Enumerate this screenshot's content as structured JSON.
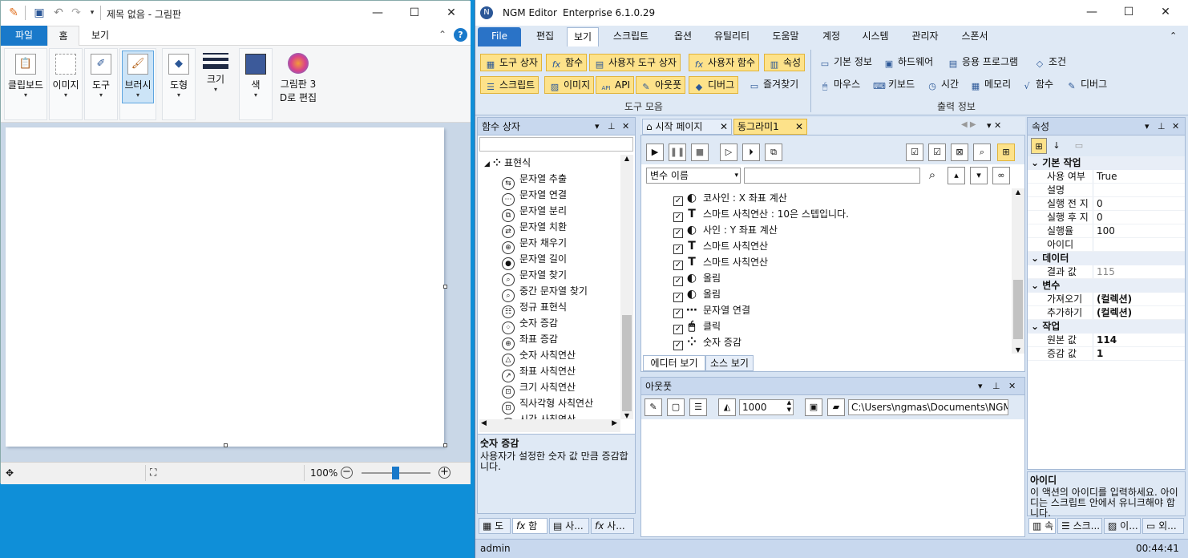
{
  "paint": {
    "title": "제목 없음 - 그림판",
    "tabs": [
      "파일",
      "홈",
      "보기"
    ],
    "ribbon": {
      "clipboard": "클립보드",
      "image": "이미지",
      "tools": "도구",
      "brush": "브러시",
      "shapes": "도형",
      "size": "크기",
      "color": "색",
      "paint3d_line1": "그림판 3",
      "paint3d_line2": "D로 편집"
    },
    "status": {
      "zoom": "100%"
    }
  },
  "ngm": {
    "app_name": "NGM Editor",
    "edition": "Enterprise 6.1.0.29",
    "tabs": [
      "File",
      "편집",
      "보기",
      "스크립트",
      "옵션",
      "유틸리티",
      "도움말",
      "계정",
      "시스템",
      "관리자",
      "스폰서"
    ],
    "tool_group": {
      "label": "도구 모음",
      "row1": [
        "도구 상자",
        "함수",
        "사용자 도구 상자",
        "사용자 함수",
        "속성"
      ],
      "row2": [
        "스크립트",
        "이미지",
        "API",
        "아웃풋",
        "디버그",
        "즐겨찾기"
      ]
    },
    "output_group": {
      "label": "출력 정보",
      "row1": [
        "기본 정보",
        "하드웨어",
        "응용 프로그램",
        "조건"
      ],
      "row2": [
        "마우스",
        "키보드",
        "시간",
        "메모리",
        "함수",
        "디버그"
      ]
    },
    "func_panel": {
      "title": "함수 상자",
      "root": "표현식",
      "items": [
        "문자열 추출",
        "문자열 연결",
        "문자열 분리",
        "문자열 치환",
        "문자 채우기",
        "문자열 길이",
        "문자열 찾기",
        "중간 문자열 찾기",
        "정규 표현식",
        "숫자 증감",
        "좌표 증감",
        "숫자 사칙연산",
        "좌표 사칙연산",
        "크기 사칙연산",
        "직사각형 사칙연산",
        "시간 사칙연산"
      ],
      "desc_title": "숫자 증감",
      "desc_text": "사용자가 설정한 숫자 값 만큼 증감합니다.",
      "bottom_tabs": [
        "도",
        "함",
        "사...",
        "사..."
      ]
    },
    "doc_tabs": [
      "시작 페이지",
      "동그라미1"
    ],
    "editor": {
      "var_select": "변수 이름",
      "lines": [
        {
          "icon": "pie",
          "text": "코사인 : X 좌표 계산"
        },
        {
          "icon": "T",
          "text": "스마트 사칙연산 : 10은 스텝입니다."
        },
        {
          "icon": "pie",
          "text": "사인 : Y 좌표 계산"
        },
        {
          "icon": "T",
          "text": "스마트 사칙연산"
        },
        {
          "icon": "T",
          "text": "스마트 사칙연산"
        },
        {
          "icon": "pie",
          "text": "올림"
        },
        {
          "icon": "pie",
          "text": "올림"
        },
        {
          "icon": "dots",
          "text": "문자열 연결"
        },
        {
          "icon": "mouse",
          "text": "클릭"
        },
        {
          "icon": "grid",
          "text": "숫자 증감"
        }
      ],
      "view_tabs": [
        "에디터 보기",
        "소스 보기"
      ]
    },
    "output_panel": {
      "title": "아웃풋",
      "count": "1000",
      "path": "C:\\Users\\ngmas\\Documents\\NGM6\\"
    },
    "props_panel": {
      "title": "속성",
      "sections": [
        {
          "name": "기본 작업",
          "rows": [
            [
              "사용 여부",
              "True"
            ],
            [
              "설명",
              ""
            ],
            [
              "실행 전 지",
              "0"
            ],
            [
              "실행 후 지",
              "0"
            ],
            [
              "실행율",
              "100"
            ],
            [
              "아이디",
              ""
            ]
          ]
        },
        {
          "name": "데이터",
          "rows": [
            [
              "결과 값",
              "115"
            ]
          ]
        },
        {
          "name": "변수",
          "rows": [
            [
              "가져오기",
              "(컬렉션)"
            ],
            [
              "추가하기",
              "(컬렉션)"
            ]
          ]
        },
        {
          "name": "작업",
          "rows": [
            [
              "원본 값",
              "114"
            ],
            [
              "증감 값",
              "1"
            ]
          ]
        }
      ],
      "desc_title": "아이디",
      "desc_text": "이 액션의 아이디를 입력하세요. 아이디는 스크립트 안에서 유니크해야 합니다.",
      "bottom_tabs": [
        "속",
        "스크...",
        "이...",
        "외..."
      ]
    },
    "status": {
      "user": "admin",
      "time": "00:44:41"
    }
  }
}
